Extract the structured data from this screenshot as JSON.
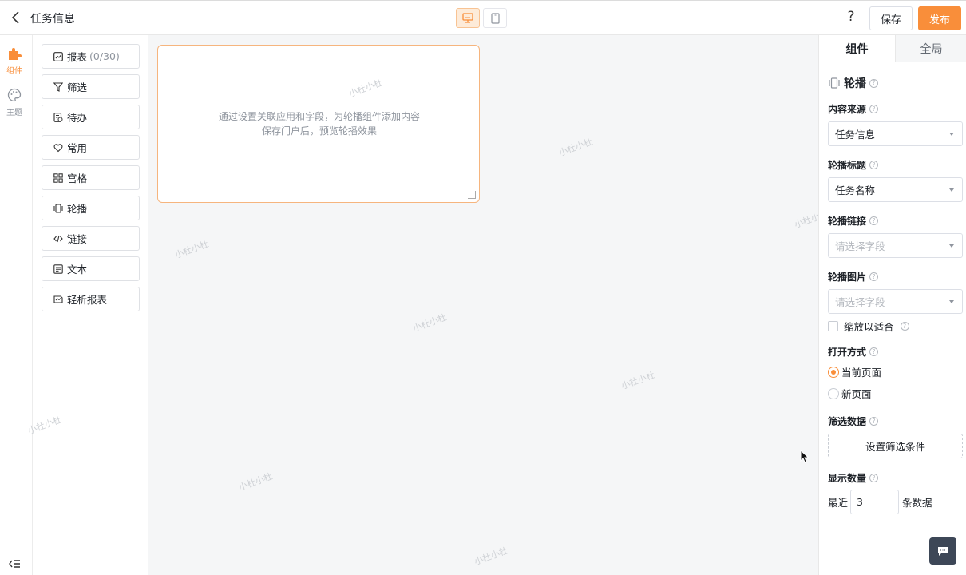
{
  "header": {
    "title": "任务信息",
    "save_label": "保存",
    "publish_label": "发布",
    "help_label": "?"
  },
  "rail": {
    "items": [
      {
        "label": "组件",
        "icon": "puzzle-icon",
        "active": true
      },
      {
        "label": "主题",
        "icon": "palette-icon",
        "active": false
      }
    ]
  },
  "components": [
    {
      "label": "报表",
      "count": "(0/30)",
      "icon": "report-icon"
    },
    {
      "label": "筛选",
      "icon": "filter-icon"
    },
    {
      "label": "待办",
      "icon": "todo-icon"
    },
    {
      "label": "常用",
      "icon": "heart-icon"
    },
    {
      "label": "宫格",
      "icon": "grid-icon"
    },
    {
      "label": "轮播",
      "icon": "carousel-icon"
    },
    {
      "label": "链接",
      "icon": "code-link-icon"
    },
    {
      "label": "文本",
      "icon": "text-icon"
    },
    {
      "label": "轻析报表",
      "icon": "analysis-icon"
    }
  ],
  "canvas": {
    "hint_line1": "通过设置关联应用和字段，为轮播组件添加内容",
    "hint_line2": "保存门户后，预览轮播效果",
    "watermark": "小杜小杜"
  },
  "props": {
    "tabs": [
      "组件",
      "全局"
    ],
    "section_title": "轮播",
    "content_source": {
      "label": "内容来源",
      "value": "任务信息"
    },
    "carousel_title": {
      "label": "轮播标题",
      "value": "任务名称"
    },
    "carousel_link": {
      "label": "轮播链接",
      "placeholder": "请选择字段"
    },
    "carousel_image": {
      "label": "轮播图片",
      "placeholder": "请选择字段"
    },
    "scale_to_fit": "缩放以适合",
    "open_mode": {
      "label": "打开方式",
      "options": [
        "当前页面",
        "新页面"
      ],
      "selected": "当前页面"
    },
    "filter_data": {
      "label": "筛选数据",
      "button": "设置筛选条件"
    },
    "display_count": {
      "label": "显示数量",
      "prefix": "最近",
      "value": "3",
      "suffix": "条数据"
    }
  },
  "colors": {
    "accent": "#f98e3a",
    "accent_light": "#fdebd9"
  }
}
